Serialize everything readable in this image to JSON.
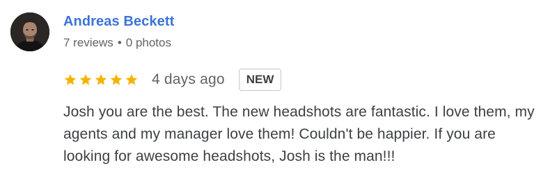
{
  "reviewer": {
    "name": "Andreas Beckett",
    "reviews_count": "7 reviews",
    "separator": "•",
    "photos_count": "0 photos"
  },
  "review": {
    "rating": 5,
    "rating_max": 5,
    "star_color": "#f4b400",
    "date": "4 days ago",
    "badge": "NEW",
    "text": "Josh you are the best. The new headshots are fantastic. I love them, my agents and my manager love them! Couldn't be happier. If you are looking for awesome headshots, Josh is the man!!!"
  },
  "colors": {
    "name": "#3b73d6",
    "meta": "#5f6368",
    "body": "#3c4043"
  },
  "icons": {
    "avatar": "profile-photo",
    "star": "star-filled-icon"
  }
}
